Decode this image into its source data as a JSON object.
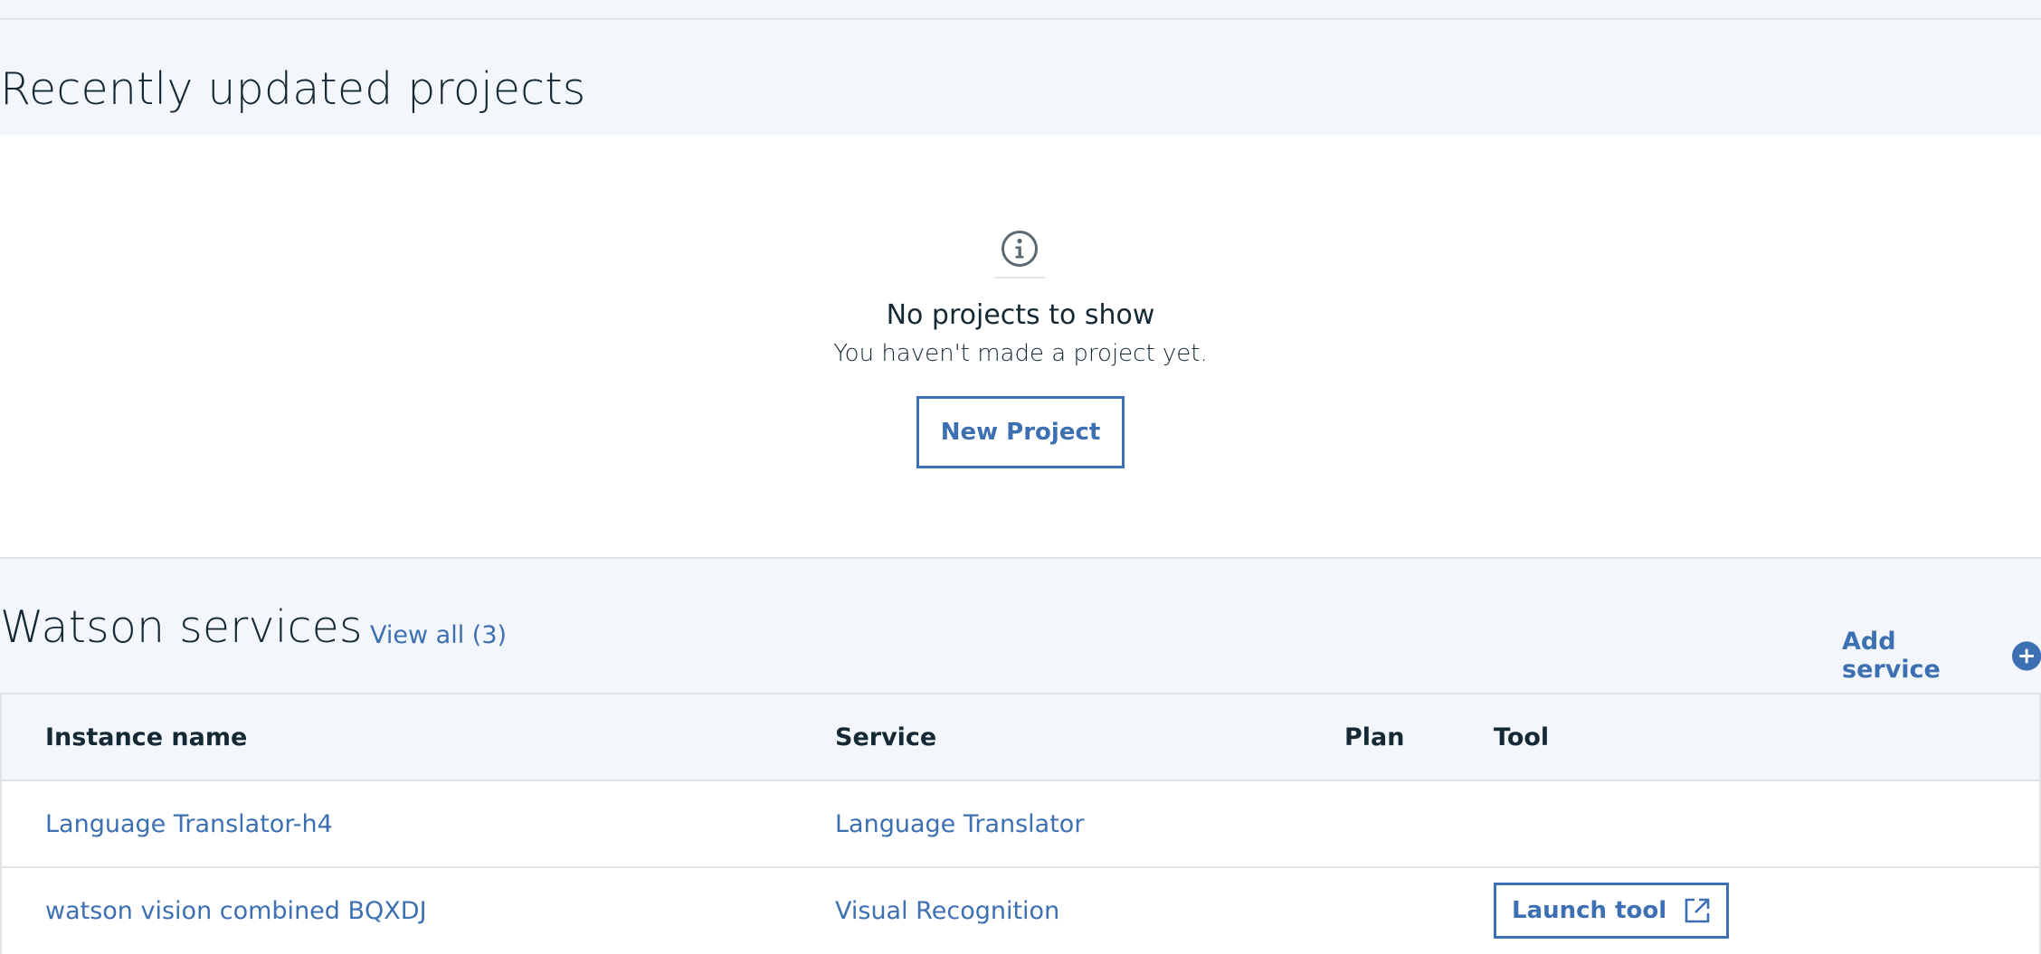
{
  "projects": {
    "title": "Recently updated projects",
    "empty_icon": "info-icon",
    "empty_title": "No projects to show",
    "empty_subtitle": "You haven't made a project yet.",
    "new_project_label": "New Project"
  },
  "services": {
    "title": "Watson services",
    "view_all_label": "View all (3)",
    "add_service_label": "Add service",
    "add_service_icon": "plus-circle-icon",
    "columns": {
      "instance_name": "Instance name",
      "service": "Service",
      "plan": "Plan",
      "tool": "Tool"
    },
    "rows": [
      {
        "instance_name": "Language Translator-h4",
        "service": "Language Translator",
        "plan": "",
        "tool": ""
      },
      {
        "instance_name": "watson vision combined BQXDJ",
        "service": "Visual Recognition",
        "plan": "",
        "tool": "Launch tool",
        "tool_icon": "external-link-icon"
      }
    ]
  },
  "colors": {
    "accent": "#3d70b2",
    "text": "#152935",
    "background": "#f3f6fa",
    "panel": "#ffffff",
    "border": "#dfe3e6"
  }
}
